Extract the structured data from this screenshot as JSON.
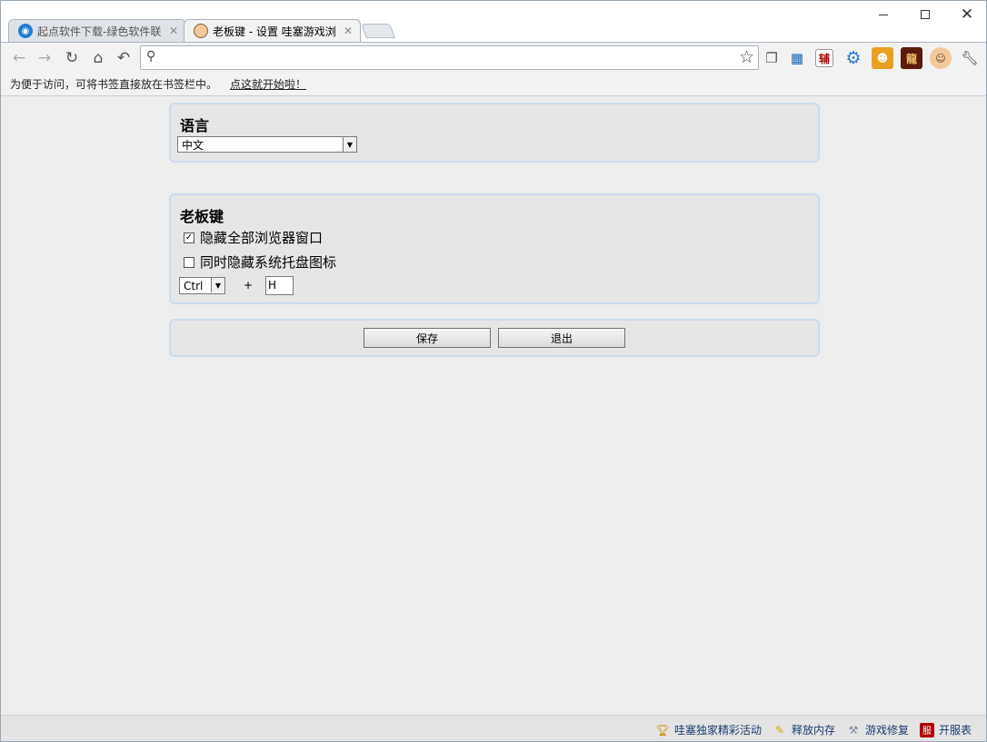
{
  "tabs": [
    {
      "title": "起点软件下载-绿色软件联",
      "favicon": "qidian-icon"
    },
    {
      "title": "老板键 - 设置 哇塞游戏浏",
      "favicon": "person-icon"
    }
  ],
  "window": {
    "minimize_icon": "minimize-icon",
    "maximize_icon": "maximize-icon",
    "close_icon": "close-icon"
  },
  "toolbar": {
    "buttons": [
      "back-icon",
      "forward-icon",
      "reload-icon",
      "home-icon",
      "undo-icon"
    ],
    "omnibox_value": "",
    "extension_icons": [
      "window-icon",
      "apps-icon",
      "fu-helper-icon",
      "gear-icon",
      "game-icon-1",
      "dragon-icon",
      "person-icon",
      "wrench-icon"
    ],
    "fu_label": "辅",
    "dragon_label": "龍"
  },
  "bookmarks": {
    "hint": "为便于访问，可将书签直接放在书签栏中。",
    "link": "点这就开始啦！"
  },
  "language": {
    "title": "语言",
    "selected": "中文"
  },
  "bosskey": {
    "title": "老板键",
    "options": [
      {
        "label": "隐藏全部浏览器窗口",
        "checked": true
      },
      {
        "label": "同时隐藏系统托盘图标",
        "checked": false
      }
    ],
    "modifier": "Ctrl",
    "plus": "+",
    "key": "H"
  },
  "actions": {
    "save": "保存",
    "exit": "退出"
  },
  "statusbar": {
    "items": [
      {
        "label": "哇塞独家精彩活动",
        "icon": "trophy-icon"
      },
      {
        "label": "释放内存",
        "icon": "broom-icon"
      },
      {
        "label": "游戏修复",
        "icon": "tools-icon"
      },
      {
        "label": "开服表",
        "icon": "server-icon",
        "icon_text": "服"
      }
    ]
  }
}
